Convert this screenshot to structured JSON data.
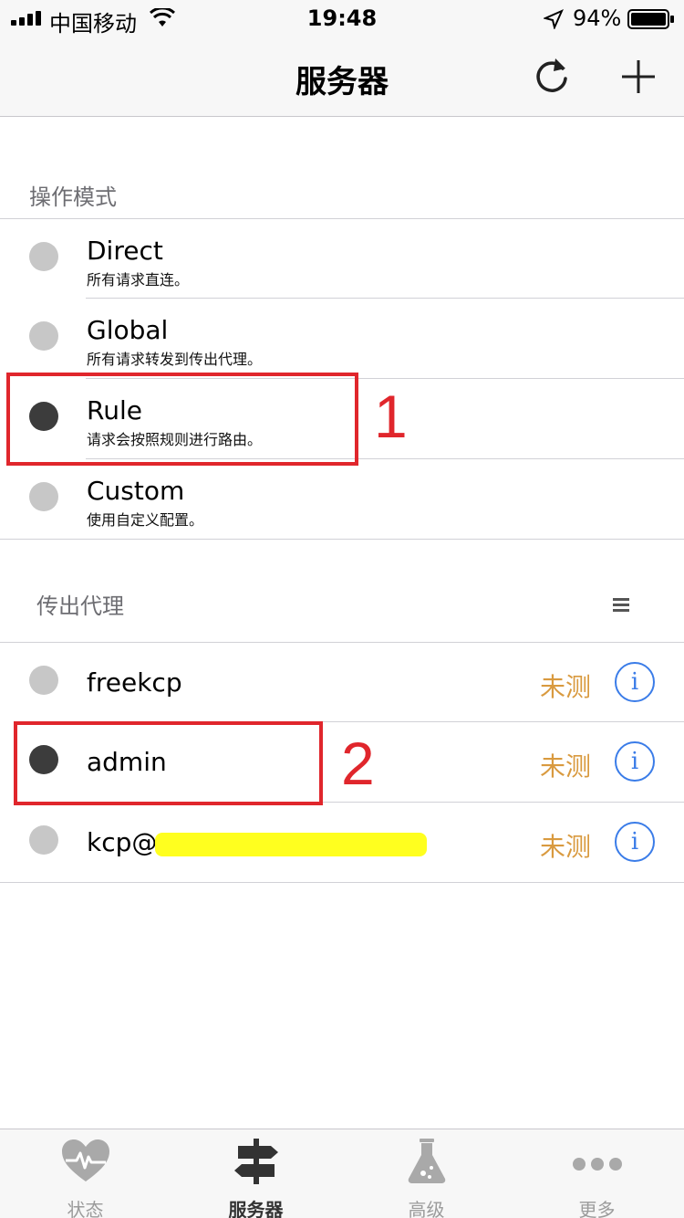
{
  "status_bar": {
    "carrier": "中国移动",
    "time": "19:48",
    "battery": "94%"
  },
  "nav": {
    "title": "服务器"
  },
  "mode_section": {
    "header": "操作模式",
    "items": [
      {
        "title": "Direct",
        "subtitle": "所有请求直连。",
        "selected": false
      },
      {
        "title": "Global",
        "subtitle": "所有请求转发到传出代理。",
        "selected": false
      },
      {
        "title": "Rule",
        "subtitle": "请求会按照规则进行路由。",
        "selected": true
      },
      {
        "title": "Custom",
        "subtitle": "使用自定义配置。",
        "selected": false
      }
    ]
  },
  "proxy_section": {
    "header": "传出代理",
    "items": [
      {
        "name": "freekcp",
        "status": "未测",
        "selected": false
      },
      {
        "name": "admin",
        "status": "未测",
        "selected": true
      },
      {
        "name": "kcp@",
        "status": "未测",
        "selected": false
      }
    ]
  },
  "annotations": {
    "one": "1",
    "two": "2"
  },
  "tabs": [
    {
      "label": "状态",
      "icon": "heart-pulse-icon",
      "active": false
    },
    {
      "label": "服务器",
      "icon": "signpost-icon",
      "active": true
    },
    {
      "label": "高级",
      "icon": "flask-icon",
      "active": false
    },
    {
      "label": "更多",
      "icon": "more-dots-icon",
      "active": false
    }
  ],
  "colors": {
    "accent_blue": "#3a7ce8",
    "status_orange": "#d99a3f",
    "annotation_red": "#e0262c",
    "redaction_yellow": "#ffff1f"
  }
}
